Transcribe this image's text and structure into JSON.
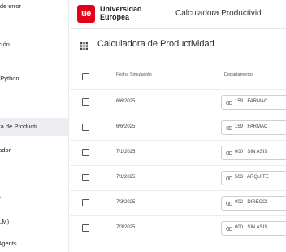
{
  "sidebar": {
    "items": [
      {
        "label": "s de error",
        "active": false
      },
      {
        "label": "l",
        "active": false
      },
      {
        "label": "ación",
        "active": false
      },
      {
        "label": "n Python",
        "active": false
      },
      {
        "label": "",
        "active": false
      },
      {
        "label": "ora de Producti...",
        "active": true
      },
      {
        "label": "dador",
        "active": false
      },
      {
        "label": "",
        "active": false
      },
      {
        "label": "IA",
        "active": false
      },
      {
        "label": "LLM)",
        "active": false
      },
      {
        "label": "l Agents",
        "active": false
      }
    ]
  },
  "header": {
    "logo_mark": "ue",
    "logo_line1": "Universidad",
    "logo_line2": "Europea",
    "title": "Calculadora Productivid"
  },
  "page": {
    "title": "Calculadora de Productividad",
    "title_icon": "grid-icon"
  },
  "table": {
    "columns": {
      "date": "Fecha Simulación",
      "department": "Departamento"
    },
    "rows": [
      {
        "date": "6/6/2025",
        "department": "159 · FARMAC"
      },
      {
        "date": "6/6/2025",
        "department": "159 · FARMAC"
      },
      {
        "date": "7/1/2025",
        "department": "000 · SIN ASIS"
      },
      {
        "date": "7/1/2025",
        "department": "503 · ARQUITE"
      },
      {
        "date": "7/3/2025",
        "department": "002 · DIRECCI"
      },
      {
        "date": "7/3/2025",
        "department": "000 · SIN ASIS"
      }
    ],
    "department_icon": "link-icon"
  },
  "colors": {
    "brand": "#e3001b",
    "active_sidebar": "#eceef2"
  }
}
